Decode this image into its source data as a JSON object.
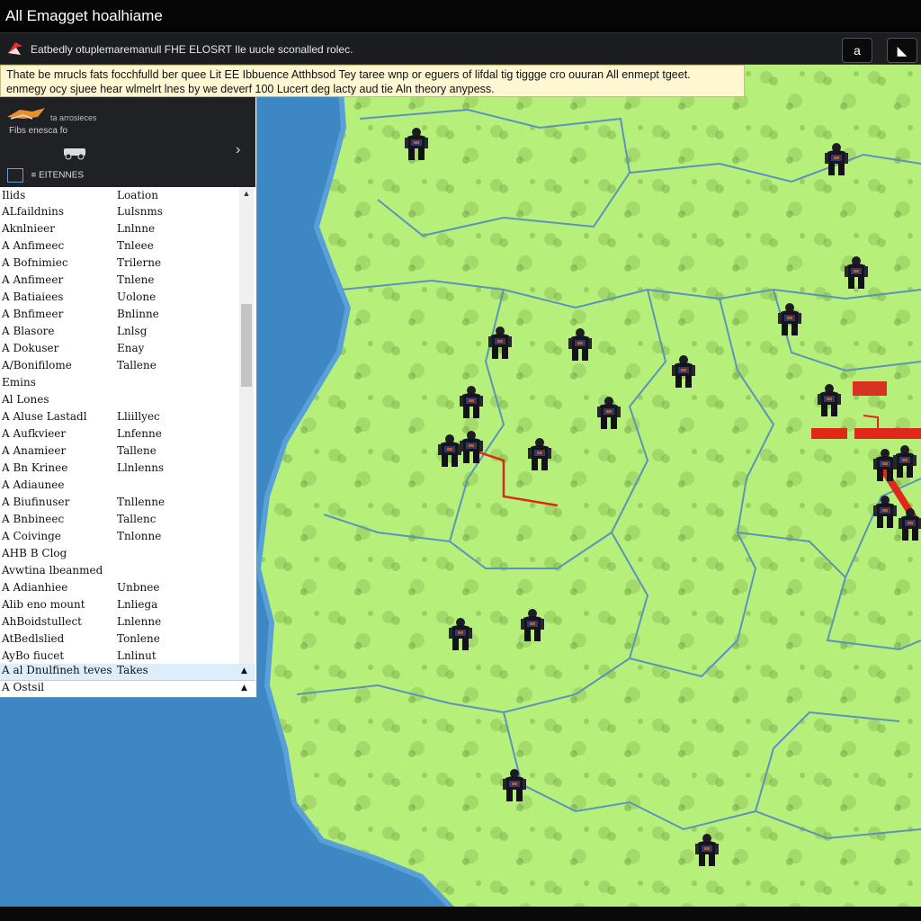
{
  "window": {
    "title": "All Emagget hoalhiame"
  },
  "toolbar": {
    "tip": "Eatbedly otuplemaremanull FHE ELOSRT Ile uucle sconalled rolec.",
    "btn_up_icon": "a",
    "btn_right_icon": "◣"
  },
  "banner": {
    "line1": "Thate be mrucls fats focchfulld ber quee Lit EE Ibbuence Atthbsod Tey taree wnp or eguers of lifdal tig tiggge cro ouuran All enmept tgeet.",
    "line2": "enmegy ocy sjuee hear wlmelrt lnes by we deverf 100 Lucert deg lacty aud tie Aln theory anypess."
  },
  "panel": {
    "unit_sub": "Fibs enesca fo",
    "unit_name": "ta arrosieces",
    "filter_label": "≡ EITENNES",
    "header": {
      "c1": "Ilids",
      "c2": "Loation"
    },
    "rows": [
      {
        "c1": "ALfaildnins",
        "c2": "Lulsnms"
      },
      {
        "c1": "Aknlnieer",
        "c2": "Lnlnne"
      },
      {
        "c1": "A Anfimeec",
        "c2": "Tnleee"
      },
      {
        "c1": "A Bofnimiec",
        "c2": "Trilerne"
      },
      {
        "c1": "A Anfimeer",
        "c2": "Tnlene"
      },
      {
        "c1": "A Batiaiees",
        "c2": "Uolone"
      },
      {
        "c1": "A Bnfimeer",
        "c2": "Bnlinne"
      },
      {
        "c1": "A Blasore",
        "c2": "Lnlsg"
      },
      {
        "c1": "A Dokuser",
        "c2": "Enay"
      },
      {
        "c1": "A/Bonifilome",
        "c2": "Tallene"
      },
      {
        "c1": "Emins",
        "c2": ""
      },
      {
        "c1": "Al Lones",
        "c2": ""
      },
      {
        "c1": "A Aluse Lastadl",
        "c2": "Lliillyec"
      },
      {
        "c1": "A Aufkvieer",
        "c2": "Lnfenne"
      },
      {
        "c1": "A Anamieer",
        "c2": "Tallene"
      },
      {
        "c1": "A Bn Krinee",
        "c2": "Llnlenns"
      },
      {
        "c1": "A Adiaunee",
        "c2": ""
      },
      {
        "c1": "A Biufinuser",
        "c2": "Tnllenne"
      },
      {
        "c1": "A Bnbineec",
        "c2": "Tallenc"
      },
      {
        "c1": "A Coivinge",
        "c2": "Tnlonne"
      },
      {
        "c1": "AHB B Clog",
        "c2": ""
      },
      {
        "c1": "Avwtina lbeanmed",
        "c2": ""
      },
      {
        "c1": "A Adianhiee",
        "c2": "Unbnee"
      },
      {
        "c1": "Alib eno mount",
        "c2": "Lnliega"
      },
      {
        "c1": "AhBoidstullect",
        "c2": "Lnlenne"
      },
      {
        "c1": "AtBedlslied",
        "c2": "Tonlene"
      },
      {
        "c1": "AyBo fiucet",
        "c2": "Lnlinut"
      }
    ],
    "selected": {
      "c1": "A al Dnulfineh teves",
      "c2": "Takes"
    },
    "bottom": {
      "c1": "A Ostsil",
      "c2": ""
    }
  },
  "map": {
    "colors": {
      "ocean": "#3d87c4",
      "land": "#b6f07a",
      "border": "#5b93ba",
      "coast": "#5aa0d8",
      "route": "#e02818"
    }
  }
}
